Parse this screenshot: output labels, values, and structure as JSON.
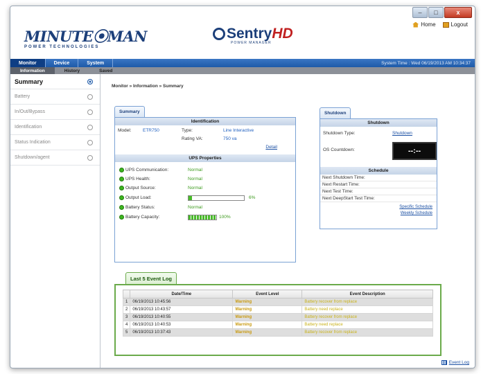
{
  "window": {
    "controls": [
      "–",
      "□",
      "x"
    ]
  },
  "header": {
    "brand_left_main": "MINUTE⦿MAN",
    "brand_left_sub": "POWER TECHNOLOGIES",
    "brand_center_main": "Sentry",
    "brand_center_hd": "HD",
    "brand_center_sub": "POWER MANAGER",
    "home_label": "Home",
    "logout_label": "Logout"
  },
  "navbar": {
    "items": [
      "Monitor",
      "Device",
      "System"
    ],
    "active": "Monitor",
    "system_time": "System Time : Wed 06/19/2013 AM 10:34:37"
  },
  "subnav": {
    "items": [
      "Information",
      "History",
      "Saved"
    ],
    "active": "Information"
  },
  "sidebar": {
    "items": [
      {
        "label": "Summary",
        "selected": true
      },
      {
        "label": "Battery",
        "selected": false
      },
      {
        "label": "In/Out/Bypass",
        "selected": false
      },
      {
        "label": "Identification",
        "selected": false
      },
      {
        "label": "Status Indication",
        "selected": false
      },
      {
        "label": "Shutdown/agent",
        "selected": false
      }
    ]
  },
  "breadcrumb": "Monitor » Information » Summary",
  "summary": {
    "tab_label": "Summary",
    "identification_title": "Identification",
    "model_label": "Model:",
    "model_value": "ETR750",
    "type_label": "Type:",
    "type_value": "Line Interactive",
    "rating_label": "Rating VA:",
    "rating_value": "750 va",
    "detail_link": "Detail",
    "properties_title": "UPS Properties",
    "properties": [
      {
        "label": "UPS Communication:",
        "value": "Normal",
        "kind": "text"
      },
      {
        "label": "UPS Health:",
        "value": "Normal",
        "kind": "text"
      },
      {
        "label": "Output Source:",
        "value": "Normal",
        "kind": "text"
      },
      {
        "label": "Output Load:",
        "value": "6%",
        "kind": "bar",
        "level": 0.06
      },
      {
        "label": "Battery Status:",
        "value": "Normal",
        "kind": "text"
      },
      {
        "label": "Battery Capacity:",
        "value": "100%",
        "kind": "segbar",
        "level": 1.0
      }
    ]
  },
  "shutdown": {
    "tab_label": "Shutdown",
    "title": "Shutdown",
    "type_label": "Shutdown Type:",
    "type_value": "Shutdown",
    "countdown_label": "OS Countdown:",
    "countdown_value": "--:--",
    "schedule_title": "Schedule",
    "schedule_rows": [
      "Next Shutdown Time:",
      "Next Restart Time:",
      "Next Test Time:",
      "Next DeepStart Test Time:"
    ],
    "link_specific": "Specific Schedule",
    "link_weekly": "Weekly Schedule"
  },
  "eventlog": {
    "tab_label": "Last 5 Event Log",
    "columns": [
      "Date/Time",
      "Event Level",
      "Event Description"
    ],
    "rows": [
      {
        "n": "1",
        "dt": "06/19/2013 10:45:56",
        "level": "Warning",
        "desc": "Battery recover from replace"
      },
      {
        "n": "2",
        "dt": "06/19/2013 10:43:57",
        "level": "Warning",
        "desc": "Battery need replace"
      },
      {
        "n": "3",
        "dt": "06/19/2013 10:40:55",
        "level": "Warning",
        "desc": "Battery recover from replace"
      },
      {
        "n": "4",
        "dt": "06/19/2013 10:40:53",
        "level": "Warning",
        "desc": "Battery need replace"
      },
      {
        "n": "5",
        "dt": "06/19/2013 10:37:43",
        "level": "Warning",
        "desc": "Battery recover from replace"
      }
    ],
    "footer_link": "Event Log"
  },
  "colors": {
    "brand_blue": "#1c3f7a",
    "nav_blue": "#1e5aa8",
    "status_green": "#3db51f",
    "warning": "#c99a10",
    "hd_red": "#c02020"
  },
  "icons": [
    "home-icon",
    "logout-icon",
    "radio-icon",
    "status-dot-icon",
    "grid-icon"
  ]
}
